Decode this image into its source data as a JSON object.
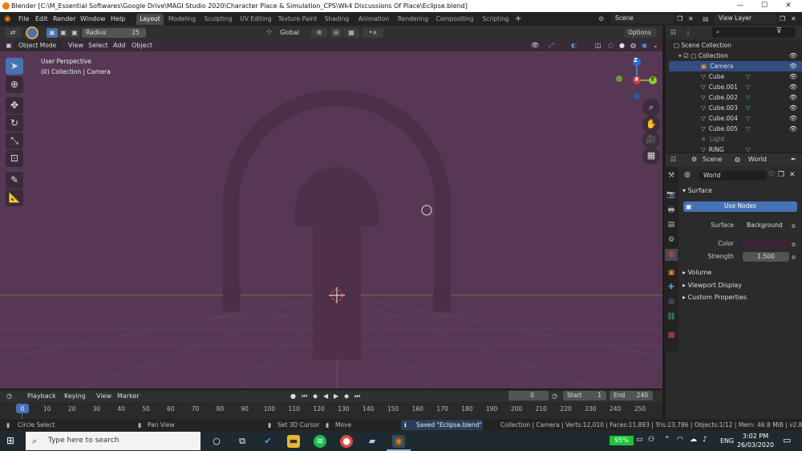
{
  "window": {
    "title": "Blender [C:\\M_Essential Softwares\\Google Drive\\MAGI Studio 2020\\Character Place & Simulation_CPS\\Wk4 Discussions Of Place\\Eclipse.blend]",
    "minimize": "—",
    "maximize": "☐",
    "close": "✕"
  },
  "menu": {
    "items": [
      "File",
      "Edit",
      "Render",
      "Window",
      "Help"
    ]
  },
  "workspaces": [
    "Layout",
    "Modeling",
    "Sculpting",
    "UV Editing",
    "Texture Paint",
    "Shading",
    "Animation",
    "Rendering",
    "Compositing",
    "Scripting"
  ],
  "workspace_add": "+",
  "scene": {
    "label": "Scene",
    "view_layer": "View Layer"
  },
  "tool_header": {
    "radius_label": "Radius",
    "radius_value": "25",
    "orientation": "Global",
    "options": "Options"
  },
  "viewport_header": {
    "mode": "Object Mode",
    "menus": [
      "View",
      "Select",
      "Add",
      "Object"
    ]
  },
  "viewport": {
    "perspective": "User Perspective",
    "collection_info": "(0) Collection | Camera",
    "background": "#563854"
  },
  "gizmo": {
    "z": "Z",
    "y": "Y",
    "x": "X"
  },
  "tools": [
    "cursor-select",
    "cursor-3d",
    "move",
    "rotate",
    "scale",
    "transform",
    "annotate",
    "measure"
  ],
  "outliner": {
    "search_placeholder": "",
    "root": "Scene Collection",
    "collection": "Collection",
    "objects": [
      {
        "name": "Camera",
        "selected": true
      },
      {
        "name": "Cube"
      },
      {
        "name": "Cube.001"
      },
      {
        "name": "Cube.002"
      },
      {
        "name": "Cube.003"
      },
      {
        "name": "Cube.004"
      },
      {
        "name": "Cube.005"
      },
      {
        "name": "Light"
      },
      {
        "name": "RING"
      }
    ]
  },
  "properties": {
    "tabs": [
      "Scene",
      "World"
    ],
    "world_name": "World",
    "surface_section": "Surface",
    "use_nodes": "Use Nodes",
    "surface_label": "Surface",
    "surface_value": "Background",
    "color_label": "Color",
    "color_value": "#3a2538",
    "strength_label": "Strength",
    "strength_value": "1.500",
    "sections": [
      "Volume",
      "Viewport Display",
      "Custom Properties"
    ]
  },
  "timeline": {
    "menus": [
      "Playback",
      "Keying",
      "View",
      "Marker"
    ],
    "current_frame": "0",
    "start_label": "Start",
    "start_value": "1",
    "end_label": "End",
    "end_value": "240",
    "ticks": [
      "0",
      "10",
      "20",
      "30",
      "40",
      "50",
      "60",
      "70",
      "80",
      "90",
      "100",
      "110",
      "120",
      "130",
      "140",
      "150",
      "160",
      "170",
      "180",
      "190",
      "200",
      "210",
      "220",
      "230",
      "240",
      "250"
    ]
  },
  "status": {
    "left_select": "Circle Select",
    "pan": "Pan View",
    "cursor": "Set 3D Cursor",
    "move": "Move",
    "saved": "Saved \"Eclipse.blend\"",
    "stats": "Collection | Camera | Verts:12,010 | Faces:11,893 | Tris:23,786 | Objects:1/12 | Mem: 46.8 MiB | v2.82.7"
  },
  "taskbar": {
    "search_placeholder": "Type here to search",
    "battery": "95%",
    "language": "ENG",
    "time": "3:02 PM",
    "date": "26/03/2020"
  }
}
